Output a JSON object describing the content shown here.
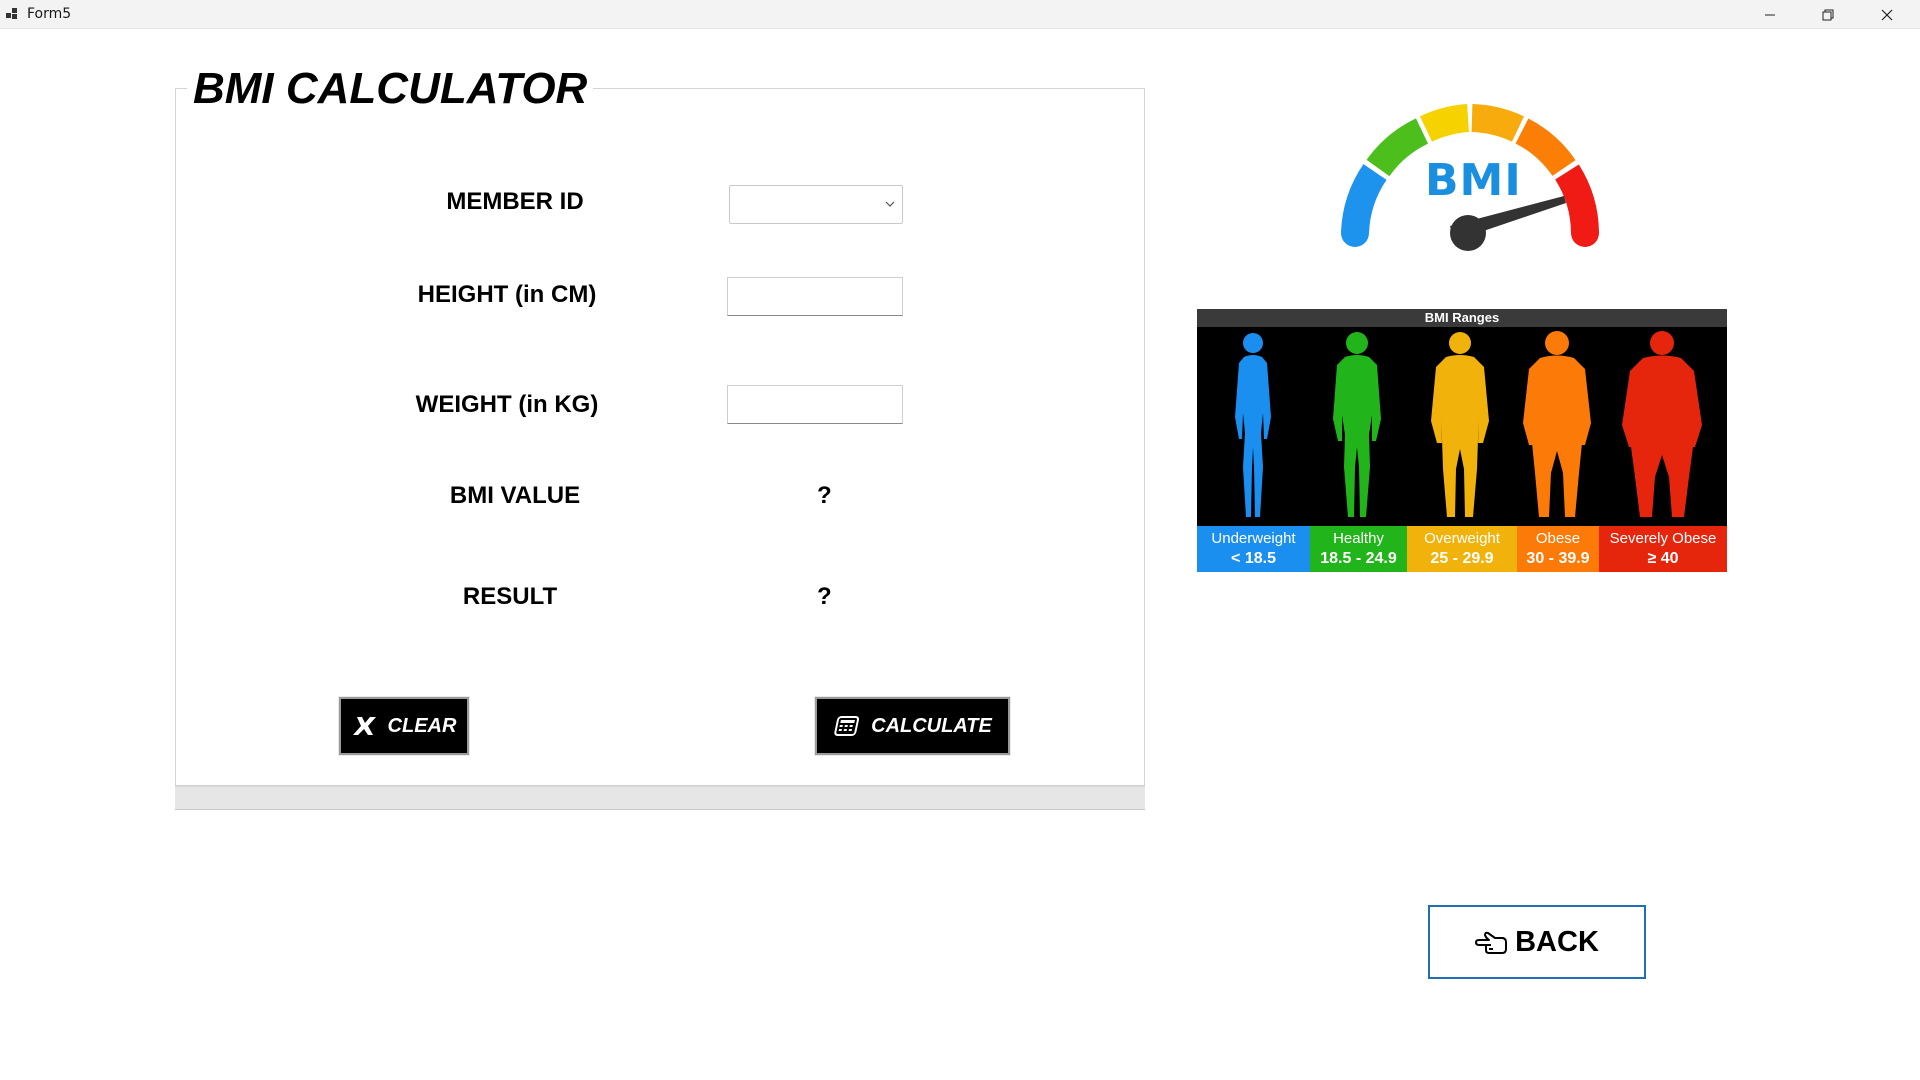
{
  "window": {
    "title": "Form5"
  },
  "form": {
    "title": "BMI CALCULATOR",
    "member_id_label": "MEMBER ID",
    "member_id_value": "",
    "height_label": "HEIGHT (in CM)",
    "height_value": "",
    "weight_label": "WEIGHT (in KG)",
    "weight_value": "",
    "bmi_label": "BMI VALUE",
    "bmi_value": "?",
    "result_label": "RESULT",
    "result_value": "?"
  },
  "buttons": {
    "clear": "CLEAR",
    "calculate": "CALCULATE",
    "back": "BACK"
  },
  "gauge": {
    "label": "BMI"
  },
  "bmi_ranges": {
    "title": "BMI Ranges",
    "categories": [
      {
        "name": "Underweight",
        "range": "< 18.5",
        "color": "#1a8ff0"
      },
      {
        "name": "Healthy",
        "range": "18.5 - 24.9",
        "color": "#22b51b"
      },
      {
        "name": "Overweight",
        "range": "25 - 29.9",
        "color": "#f2b20c"
      },
      {
        "name": "Obese",
        "range": "30 - 39.9",
        "color": "#fb7a08"
      },
      {
        "name": "Severely Obese",
        "range": "≥ 40",
        "color": "#e5260d"
      }
    ]
  },
  "icons": {
    "app": "app-icon",
    "clear": "x-icon",
    "calculate": "calculator-icon",
    "back": "pointing-hand-icon"
  }
}
